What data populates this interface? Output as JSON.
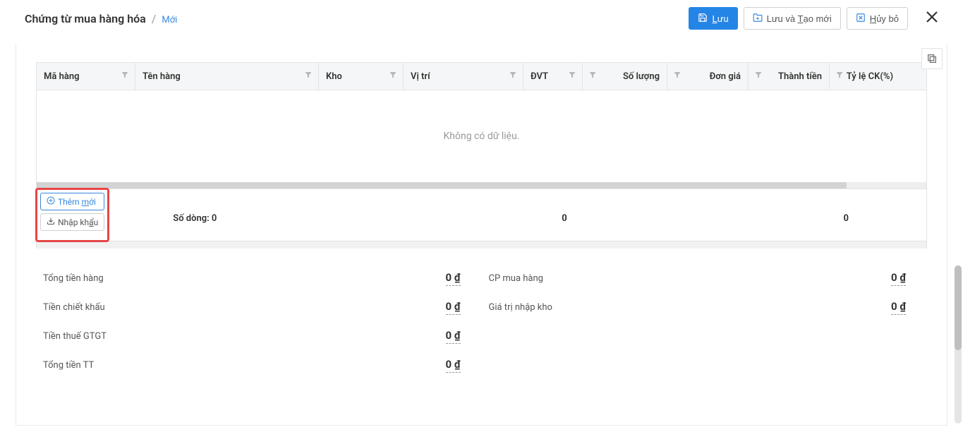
{
  "header": {
    "title": "Chứng từ mua hàng hóa",
    "status": "Mới",
    "buttons": {
      "save_pre": "",
      "save_letter": "L",
      "save_rest": "ưu",
      "save_new_pre": "Lưu và ",
      "save_new_letter": "T",
      "save_new_rest": "ạo mới",
      "cancel_pre": "",
      "cancel_letter": "H",
      "cancel_rest": "ủy bỏ"
    }
  },
  "grid": {
    "columns": {
      "mahang": "Mã hàng",
      "tenhang": "Tên hàng",
      "kho": "Kho",
      "vitri": "Vị trí",
      "dvt": "ĐVT",
      "soluong": "Số lượng",
      "dongia": "Đơn giá",
      "thanhtien": "Thành tiền",
      "tyleck": "Tỷ lệ CK(%)"
    },
    "empty_text": "Không có dữ liệu.",
    "row_count_label": "Số dòng: 0",
    "sum_soluong": "0",
    "sum_thanhtien": "0"
  },
  "actions": {
    "add_pre": "Thêm ",
    "add_letter": "m",
    "add_rest": "ới",
    "import_pre": "Nhập kh",
    "import_letter": "ẩ",
    "import_rest": "u"
  },
  "totals": {
    "left": {
      "tong_tien_hang": {
        "label": "Tổng tiền hàng",
        "value": "0 ₫"
      },
      "tien_chiet_khau": {
        "label": "Tiền chiết khấu",
        "value": "0 ₫"
      },
      "tien_thue_gtgt": {
        "label": "Tiền thuế GTGT",
        "value": "0 ₫"
      },
      "tong_tien_tt": {
        "label": "Tổng tiền TT",
        "value": "0 ₫"
      }
    },
    "right": {
      "cp_mua_hang": {
        "label": "CP mua hàng",
        "value": "0 ₫"
      },
      "gia_tri_nhap_kho": {
        "label": "Giá trị nhập kho",
        "value": "0 ₫"
      }
    }
  }
}
